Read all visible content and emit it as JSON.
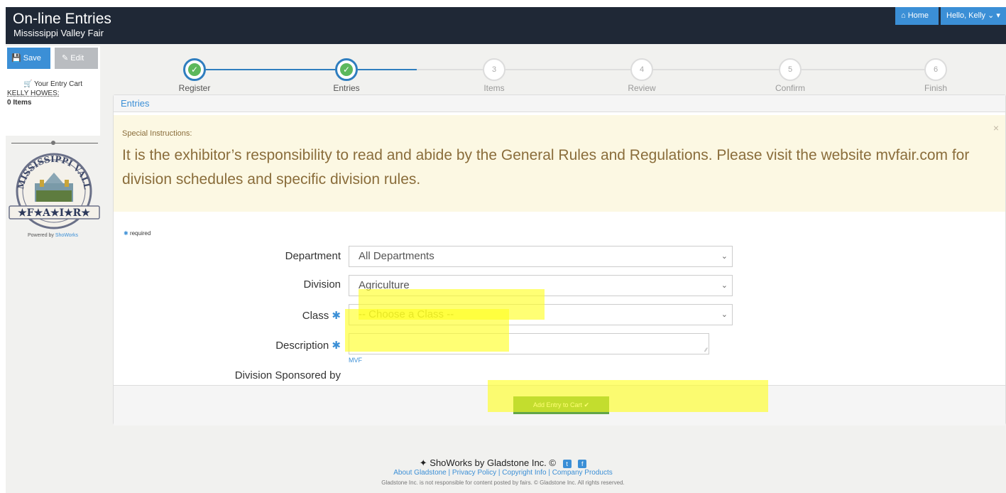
{
  "header": {
    "title": "On-line Entries",
    "subtitle": "Mississippi Valley Fair",
    "home_label": "⌂ Home",
    "user_label": "Hello, Kelly ⌄ ▾"
  },
  "sidebar": {
    "save_label": "Save",
    "edit_label": "Edit",
    "cart_title": "Your Entry Cart",
    "cart_name": "KELLY HOWES:",
    "cart_items": "0 Items",
    "powered_prefix": "Powered by ",
    "powered_link": "ShoWorks",
    "logo_text_top": "MISSISSIPPI VALLEY",
    "logo_text_bottom": "★F★A★I★R★"
  },
  "steps": [
    {
      "num": "",
      "label": "Register",
      "done": true
    },
    {
      "num": "",
      "label": "Entries",
      "done": true
    },
    {
      "num": "3",
      "label": "Items",
      "done": false
    },
    {
      "num": "4",
      "label": "Review",
      "done": false
    },
    {
      "num": "5",
      "label": "Confirm",
      "done": false
    },
    {
      "num": "6",
      "label": "Finish",
      "done": false
    }
  ],
  "panel": {
    "heading": "Entries",
    "instructions_title": "Special Instructions:",
    "instructions_text": "It is the exhibitor’s responsibility to read and abide by the General Rules and Regulations. Please visit the website mvfair.com for division schedules and specific division rules.",
    "close": "×"
  },
  "form": {
    "required_note": "required",
    "department_label": "Department",
    "department_value": "All Departments",
    "division_label": "Division",
    "division_value": "Agriculture",
    "class_label": "Class",
    "class_value": "-- Choose a Class --",
    "description_label": "Description",
    "description_value": "",
    "sponsor_label": "Division Sponsored by",
    "sponsor_value": "MVF",
    "add_button": "Add Entry to Cart  ✔"
  },
  "footer": {
    "brand": "ShoWorks by Gladstone Inc. ©",
    "links": "About Gladstone | Privacy Policy | Copyright Info | Company Products",
    "legal": "Gladstone Inc. is not responsible for content posted by fairs. © Gladstone Inc. All rights reserved."
  },
  "colors": {
    "accent": "#3b8fd6",
    "header_bg": "#1f2836",
    "success": "#62a548",
    "warning_bg": "#fcf8e3",
    "warning_text": "#8a6d3b",
    "highlight": "#ffff1e"
  }
}
